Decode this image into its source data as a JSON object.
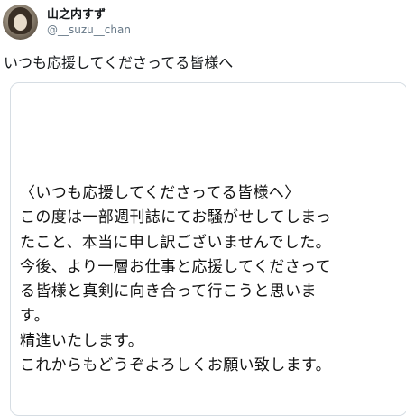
{
  "user": {
    "display_name": "山之内すず",
    "handle": "@__suzu__chan"
  },
  "tweet": {
    "text": "いつも応援してくださってる皆様へ"
  },
  "image": {
    "lines": [
      "〈いつも応援してくださってる皆様へ〉",
      "この度は一部週刊誌にてお騒がせしてしまっ",
      "たこと、本当に申し訳ございませんでした。",
      "今後、より一層お仕事と応援してくださって",
      "る皆様と真剣に向き合って行こうと思いま",
      "す。",
      "精進いたします。",
      "これからもどうぞよろしくお願い致します。"
    ]
  }
}
